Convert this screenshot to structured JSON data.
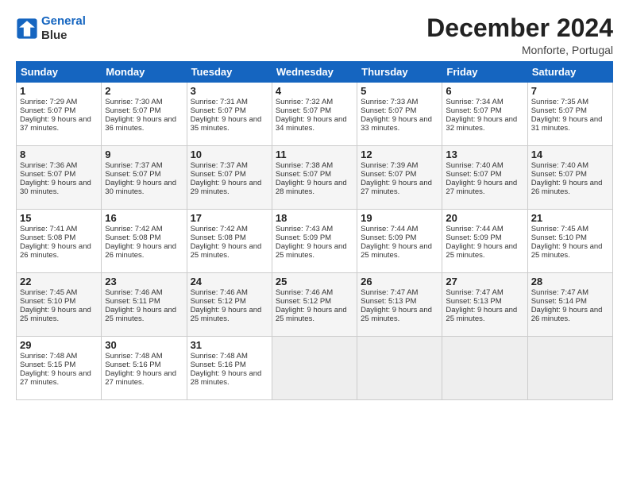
{
  "header": {
    "logo_line1": "General",
    "logo_line2": "Blue",
    "month_title": "December 2024",
    "subtitle": "Monforte, Portugal"
  },
  "days_of_week": [
    "Sunday",
    "Monday",
    "Tuesday",
    "Wednesday",
    "Thursday",
    "Friday",
    "Saturday"
  ],
  "weeks": [
    [
      {
        "day": "1",
        "sunrise": "Sunrise: 7:29 AM",
        "sunset": "Sunset: 5:07 PM",
        "daylight": "Daylight: 9 hours and 37 minutes."
      },
      {
        "day": "2",
        "sunrise": "Sunrise: 7:30 AM",
        "sunset": "Sunset: 5:07 PM",
        "daylight": "Daylight: 9 hours and 36 minutes."
      },
      {
        "day": "3",
        "sunrise": "Sunrise: 7:31 AM",
        "sunset": "Sunset: 5:07 PM",
        "daylight": "Daylight: 9 hours and 35 minutes."
      },
      {
        "day": "4",
        "sunrise": "Sunrise: 7:32 AM",
        "sunset": "Sunset: 5:07 PM",
        "daylight": "Daylight: 9 hours and 34 minutes."
      },
      {
        "day": "5",
        "sunrise": "Sunrise: 7:33 AM",
        "sunset": "Sunset: 5:07 PM",
        "daylight": "Daylight: 9 hours and 33 minutes."
      },
      {
        "day": "6",
        "sunrise": "Sunrise: 7:34 AM",
        "sunset": "Sunset: 5:07 PM",
        "daylight": "Daylight: 9 hours and 32 minutes."
      },
      {
        "day": "7",
        "sunrise": "Sunrise: 7:35 AM",
        "sunset": "Sunset: 5:07 PM",
        "daylight": "Daylight: 9 hours and 31 minutes."
      }
    ],
    [
      {
        "day": "8",
        "sunrise": "Sunrise: 7:36 AM",
        "sunset": "Sunset: 5:07 PM",
        "daylight": "Daylight: 9 hours and 30 minutes."
      },
      {
        "day": "9",
        "sunrise": "Sunrise: 7:37 AM",
        "sunset": "Sunset: 5:07 PM",
        "daylight": "Daylight: 9 hours and 30 minutes."
      },
      {
        "day": "10",
        "sunrise": "Sunrise: 7:37 AM",
        "sunset": "Sunset: 5:07 PM",
        "daylight": "Daylight: 9 hours and 29 minutes."
      },
      {
        "day": "11",
        "sunrise": "Sunrise: 7:38 AM",
        "sunset": "Sunset: 5:07 PM",
        "daylight": "Daylight: 9 hours and 28 minutes."
      },
      {
        "day": "12",
        "sunrise": "Sunrise: 7:39 AM",
        "sunset": "Sunset: 5:07 PM",
        "daylight": "Daylight: 9 hours and 27 minutes."
      },
      {
        "day": "13",
        "sunrise": "Sunrise: 7:40 AM",
        "sunset": "Sunset: 5:07 PM",
        "daylight": "Daylight: 9 hours and 27 minutes."
      },
      {
        "day": "14",
        "sunrise": "Sunrise: 7:40 AM",
        "sunset": "Sunset: 5:07 PM",
        "daylight": "Daylight: 9 hours and 26 minutes."
      }
    ],
    [
      {
        "day": "15",
        "sunrise": "Sunrise: 7:41 AM",
        "sunset": "Sunset: 5:08 PM",
        "daylight": "Daylight: 9 hours and 26 minutes."
      },
      {
        "day": "16",
        "sunrise": "Sunrise: 7:42 AM",
        "sunset": "Sunset: 5:08 PM",
        "daylight": "Daylight: 9 hours and 26 minutes."
      },
      {
        "day": "17",
        "sunrise": "Sunrise: 7:42 AM",
        "sunset": "Sunset: 5:08 PM",
        "daylight": "Daylight: 9 hours and 25 minutes."
      },
      {
        "day": "18",
        "sunrise": "Sunrise: 7:43 AM",
        "sunset": "Sunset: 5:09 PM",
        "daylight": "Daylight: 9 hours and 25 minutes."
      },
      {
        "day": "19",
        "sunrise": "Sunrise: 7:44 AM",
        "sunset": "Sunset: 5:09 PM",
        "daylight": "Daylight: 9 hours and 25 minutes."
      },
      {
        "day": "20",
        "sunrise": "Sunrise: 7:44 AM",
        "sunset": "Sunset: 5:09 PM",
        "daylight": "Daylight: 9 hours and 25 minutes."
      },
      {
        "day": "21",
        "sunrise": "Sunrise: 7:45 AM",
        "sunset": "Sunset: 5:10 PM",
        "daylight": "Daylight: 9 hours and 25 minutes."
      }
    ],
    [
      {
        "day": "22",
        "sunrise": "Sunrise: 7:45 AM",
        "sunset": "Sunset: 5:10 PM",
        "daylight": "Daylight: 9 hours and 25 minutes."
      },
      {
        "day": "23",
        "sunrise": "Sunrise: 7:46 AM",
        "sunset": "Sunset: 5:11 PM",
        "daylight": "Daylight: 9 hours and 25 minutes."
      },
      {
        "day": "24",
        "sunrise": "Sunrise: 7:46 AM",
        "sunset": "Sunset: 5:12 PM",
        "daylight": "Daylight: 9 hours and 25 minutes."
      },
      {
        "day": "25",
        "sunrise": "Sunrise: 7:46 AM",
        "sunset": "Sunset: 5:12 PM",
        "daylight": "Daylight: 9 hours and 25 minutes."
      },
      {
        "day": "26",
        "sunrise": "Sunrise: 7:47 AM",
        "sunset": "Sunset: 5:13 PM",
        "daylight": "Daylight: 9 hours and 25 minutes."
      },
      {
        "day": "27",
        "sunrise": "Sunrise: 7:47 AM",
        "sunset": "Sunset: 5:13 PM",
        "daylight": "Daylight: 9 hours and 25 minutes."
      },
      {
        "day": "28",
        "sunrise": "Sunrise: 7:47 AM",
        "sunset": "Sunset: 5:14 PM",
        "daylight": "Daylight: 9 hours and 26 minutes."
      }
    ],
    [
      {
        "day": "29",
        "sunrise": "Sunrise: 7:48 AM",
        "sunset": "Sunset: 5:15 PM",
        "daylight": "Daylight: 9 hours and 27 minutes."
      },
      {
        "day": "30",
        "sunrise": "Sunrise: 7:48 AM",
        "sunset": "Sunset: 5:16 PM",
        "daylight": "Daylight: 9 hours and 27 minutes."
      },
      {
        "day": "31",
        "sunrise": "Sunrise: 7:48 AM",
        "sunset": "Sunset: 5:16 PM",
        "daylight": "Daylight: 9 hours and 28 minutes."
      },
      null,
      null,
      null,
      null
    ]
  ]
}
